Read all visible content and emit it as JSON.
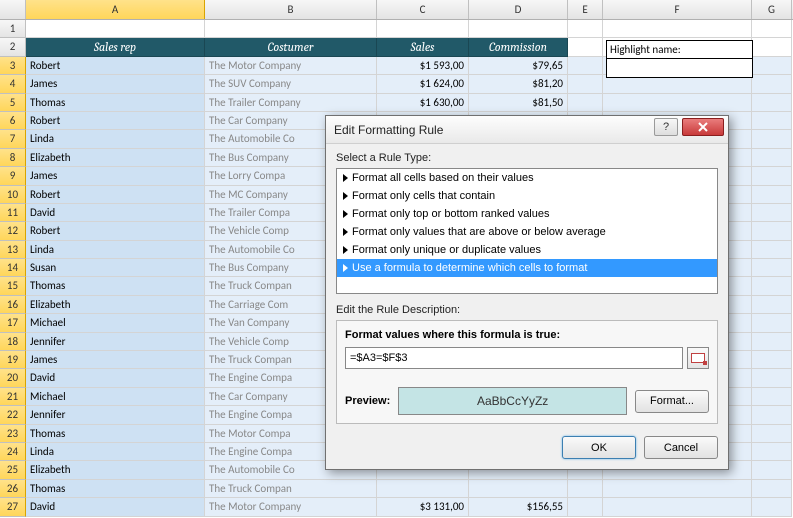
{
  "columns": [
    "A",
    "B",
    "C",
    "D",
    "E",
    "F",
    "G"
  ],
  "highlight_label": "Highlight name:",
  "headers": {
    "a": "Sales rep",
    "b": "Costumer",
    "c": "Sales",
    "d": "Commission"
  },
  "rows": [
    {
      "n": 1,
      "a": "",
      "b": "",
      "c": "",
      "d": ""
    },
    {
      "n": 2,
      "a": "Sales rep",
      "b": "Costumer",
      "c": "Sales",
      "d": "Commission",
      "hdr": true
    },
    {
      "n": 3,
      "a": "Robert",
      "b": "The Motor Company",
      "c": "$1 593,00",
      "d": "$79,65"
    },
    {
      "n": 4,
      "a": "James",
      "b": "The SUV Company",
      "c": "$1 624,00",
      "d": "$81,20"
    },
    {
      "n": 5,
      "a": "Thomas",
      "b": "The Trailer Company",
      "c": "$1 630,00",
      "d": "$81,50"
    },
    {
      "n": 6,
      "a": "Robert",
      "b": "The Car Company",
      "c": "",
      "d": ""
    },
    {
      "n": 7,
      "a": "Linda",
      "b": "The Automobile Co",
      "c": "",
      "d": ""
    },
    {
      "n": 8,
      "a": "Elizabeth",
      "b": "The Bus Company",
      "c": "",
      "d": ""
    },
    {
      "n": 9,
      "a": "James",
      "b": "The Lorry Compa",
      "c": "",
      "d": ""
    },
    {
      "n": 10,
      "a": "Robert",
      "b": "The MC Company",
      "c": "",
      "d": ""
    },
    {
      "n": 11,
      "a": "David",
      "b": "The Trailer Compa",
      "c": "",
      "d": ""
    },
    {
      "n": 12,
      "a": "Robert",
      "b": "The Vehicle Comp",
      "c": "",
      "d": ""
    },
    {
      "n": 13,
      "a": "Linda",
      "b": "The Automobile Co",
      "c": "",
      "d": ""
    },
    {
      "n": 14,
      "a": "Susan",
      "b": "The Bus Company",
      "c": "",
      "d": ""
    },
    {
      "n": 15,
      "a": "Thomas",
      "b": "The Truck Compan",
      "c": "",
      "d": ""
    },
    {
      "n": 16,
      "a": "Elizabeth",
      "b": "The Carriage Com",
      "c": "",
      "d": ""
    },
    {
      "n": 17,
      "a": "Michael",
      "b": "The Van Company",
      "c": "",
      "d": ""
    },
    {
      "n": 18,
      "a": "Jennifer",
      "b": "The Vehicle Comp",
      "c": "",
      "d": ""
    },
    {
      "n": 19,
      "a": "James",
      "b": "The Truck Compan",
      "c": "",
      "d": ""
    },
    {
      "n": 20,
      "a": "David",
      "b": "The Engine Compa",
      "c": "",
      "d": ""
    },
    {
      "n": 21,
      "a": "Michael",
      "b": "The Car Company",
      "c": "",
      "d": ""
    },
    {
      "n": 22,
      "a": "Jennifer",
      "b": "The Engine Compa",
      "c": "",
      "d": ""
    },
    {
      "n": 23,
      "a": "Thomas",
      "b": "The Motor Compa",
      "c": "",
      "d": ""
    },
    {
      "n": 24,
      "a": "Linda",
      "b": "The Engine Compa",
      "c": "",
      "d": ""
    },
    {
      "n": 25,
      "a": "Elizabeth",
      "b": "The Automobile Co",
      "c": "",
      "d": ""
    },
    {
      "n": 26,
      "a": "Thomas",
      "b": "The Truck Compan",
      "c": "",
      "d": ""
    },
    {
      "n": 27,
      "a": "David",
      "b": "The Motor Company",
      "c": "$3 131,00",
      "d": "$156,55"
    }
  ],
  "dialog": {
    "title": "Edit Formatting Rule",
    "help": "?",
    "select_label": "Select a Rule Type:",
    "rules": [
      "Format all cells based on their values",
      "Format only cells that contain",
      "Format only top or bottom ranked values",
      "Format only values that are above or below average",
      "Format only unique or duplicate values",
      "Use a formula to determine which cells to format"
    ],
    "selected_rule_index": 5,
    "desc_label": "Edit the Rule Description:",
    "formula_label": "Format values where this formula is true:",
    "formula_value": "=$A3=$F$3",
    "preview_label": "Preview:",
    "preview_text": "AaBbCcYyZz",
    "format_btn": "Format...",
    "ok": "OK",
    "cancel": "Cancel"
  }
}
